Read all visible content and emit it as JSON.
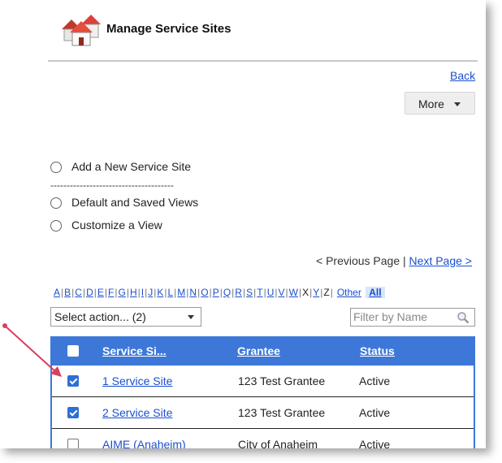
{
  "header": {
    "title": "Manage Service Sites"
  },
  "nav": {
    "back": "Back",
    "more": "More"
  },
  "options": [
    {
      "label": "Add a New Service Site"
    },
    {
      "label": "Default and Saved Views"
    },
    {
      "label": "Customize a View"
    }
  ],
  "divider": "--------------------------------------",
  "pager": {
    "previous": "< Previous Page",
    "separator": "|",
    "next": "Next Page >"
  },
  "alphabet": [
    "A",
    "B",
    "C",
    "D",
    "E",
    "F",
    "G",
    "H",
    "I",
    "J",
    "K",
    "L",
    "M",
    "N",
    "O",
    "P",
    "Q",
    "R",
    "S",
    "T",
    "U",
    "V",
    "W",
    "X",
    "Y",
    "Z"
  ],
  "alphabet_plain": [
    "X",
    "Z"
  ],
  "alphabet_other": "Other",
  "alphabet_all": "All",
  "action_select": {
    "value": "Select action... (2)"
  },
  "filter": {
    "placeholder": "Filter by Name"
  },
  "table": {
    "columns": [
      "Service Si...",
      "Grantee",
      "Status"
    ],
    "rows": [
      {
        "checked": true,
        "site": "1 Service Site",
        "grantee": "123 Test Grantee",
        "status": "Active"
      },
      {
        "checked": true,
        "site": "2 Service Site",
        "grantee": "123 Test Grantee",
        "status": "Active"
      },
      {
        "checked": false,
        "site": "AIME (Anaheim)",
        "grantee": "City of Anaheim",
        "status": "Active"
      }
    ]
  },
  "colors": {
    "header_blue": "#3d78d8",
    "link_blue": "#1a4fd0",
    "annotation_arrow": "#d9405e"
  },
  "icons": {
    "logo": "houses-logo-icon",
    "search": "magnifier-icon",
    "annotation": "pointer-arrow"
  }
}
